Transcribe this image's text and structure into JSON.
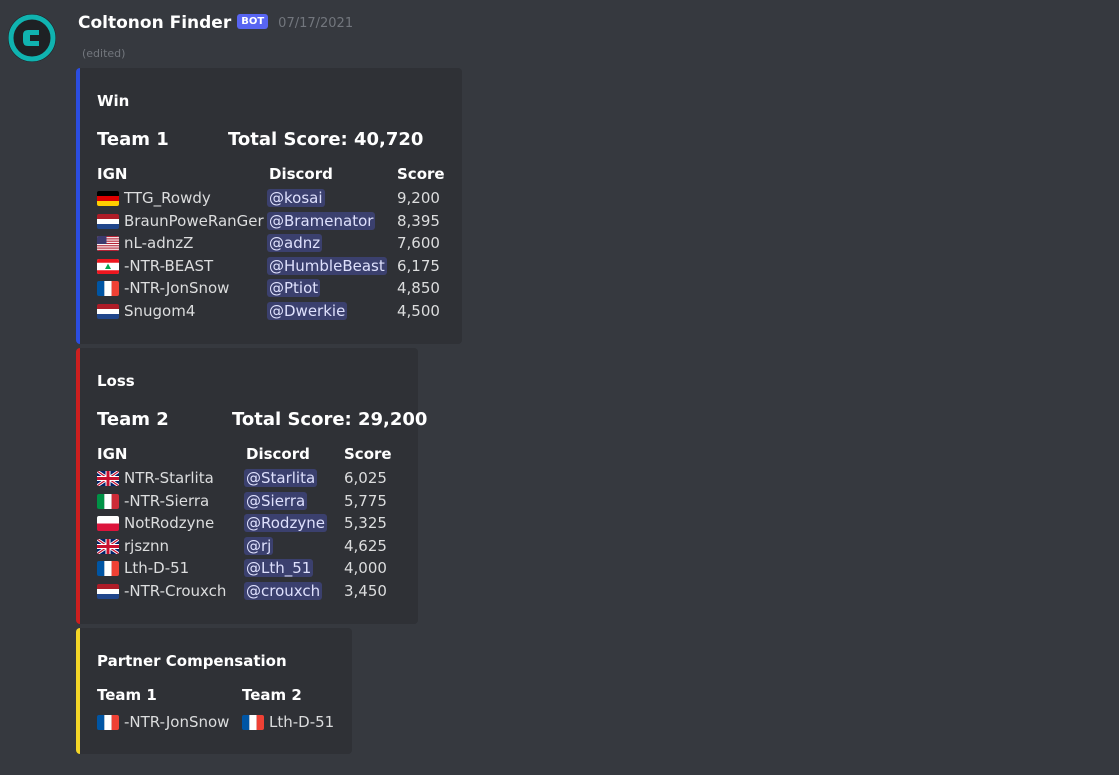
{
  "bot": {
    "name": "Coltonon Finder",
    "tag": "BOT",
    "timestamp": "07/17/2021",
    "edited": "(edited)",
    "avatar_icon": "coltonon-logo-icon",
    "accent": "#10b3b0"
  },
  "embeds": {
    "win": {
      "color": "#2b4de0",
      "title": "Win",
      "team": "Team 1",
      "total": "Total Score: 40,720",
      "headers": {
        "ign": "IGN",
        "discord": "Discord",
        "score": "Score"
      },
      "rows": [
        {
          "flag": "de",
          "ign": "TTG_Rowdy",
          "discord": "@kosai",
          "score": "9,200"
        },
        {
          "flag": "nl",
          "ign": "BraunPoweRanGer",
          "discord": "@Bramenator",
          "score": "8,395"
        },
        {
          "flag": "us",
          "ign": "nL-adnzZ",
          "discord": "@adnz",
          "score": "7,600"
        },
        {
          "flag": "lb",
          "ign": "-NTR-BEAST",
          "discord": "@HumbleBeast",
          "score": "6,175"
        },
        {
          "flag": "fr",
          "ign": "-NTR-JonSnow",
          "discord": "@Ptiot",
          "score": "4,850"
        },
        {
          "flag": "nl",
          "ign": "Snugom4",
          "discord": "@Dwerkie",
          "score": "4,500"
        }
      ]
    },
    "loss": {
      "color": "#cc1f1f",
      "title": "Loss",
      "team": "Team 2",
      "total": "Total Score: 29,200",
      "headers": {
        "ign": "IGN",
        "discord": "Discord",
        "score": "Score"
      },
      "rows": [
        {
          "flag": "gb",
          "ign": "NTR-Starlita",
          "discord": "@Starlita",
          "score": "6,025"
        },
        {
          "flag": "it",
          "ign": "-NTR-Sierra",
          "discord": "@Sierra",
          "score": "5,775"
        },
        {
          "flag": "pl",
          "ign": "NotRodzyne",
          "discord": "@Rodzyne",
          "score": "5,325"
        },
        {
          "flag": "gb",
          "ign": "rjsznn",
          "discord": "@rj",
          "score": "4,625"
        },
        {
          "flag": "fr",
          "ign": "Lth-D-51",
          "discord": "@Lth_51",
          "score": "4,000"
        },
        {
          "flag": "nl",
          "ign": "-NTR-Crouxch",
          "discord": "@crouxch",
          "score": "3,450"
        }
      ]
    },
    "partner": {
      "color": "#f4d627",
      "title": "Partner Compensation",
      "team1": "Team 1",
      "team2": "Team 2",
      "team1_player": {
        "flag": "fr",
        "ign": "-NTR-JonSnow"
      },
      "team2_player": {
        "flag": "fr",
        "ign": "Lth-D-51"
      }
    }
  }
}
